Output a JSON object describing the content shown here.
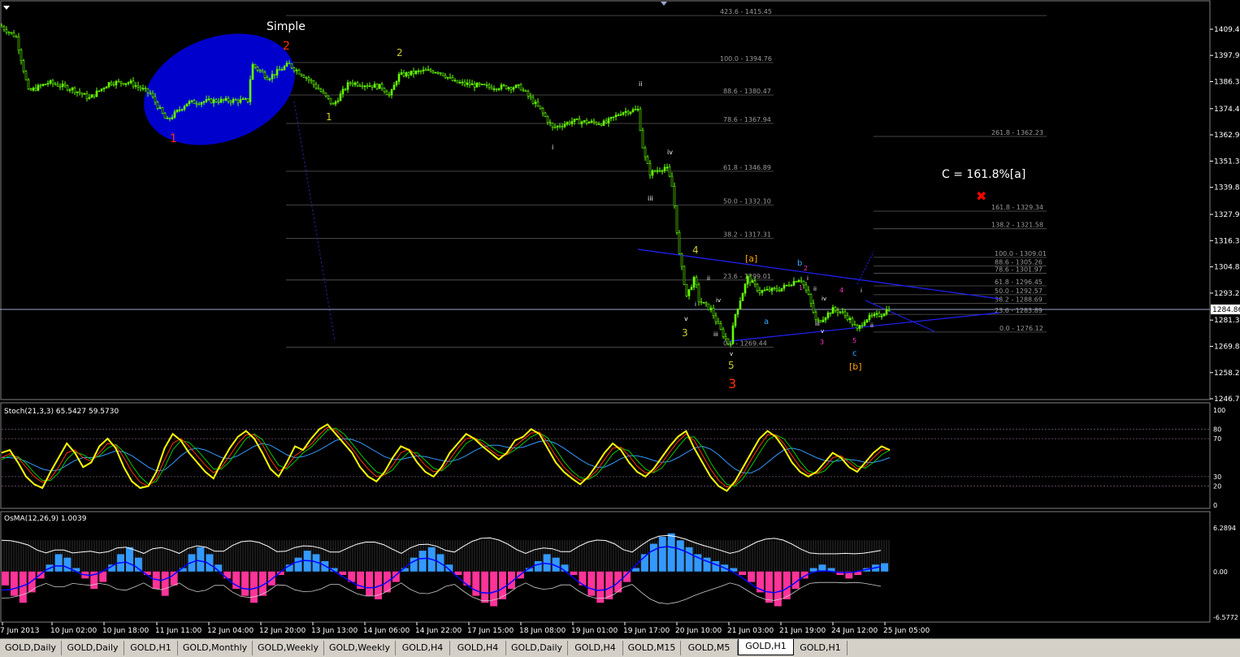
{
  "chart_data": [
    {
      "type": "candlestick",
      "symbol": "GOLD",
      "timeframe": "H1",
      "ylim": [
        1246.75,
        1418.0
      ],
      "y_ticks": [
        "1409.42",
        "1397.90",
        "1386.37",
        "1374.45",
        "1362.92",
        "1351.37",
        "1339.82",
        "1327.90",
        "1316.37",
        "1304.82",
        "1293.27",
        "1281.37",
        "1269.82",
        "1258.27",
        "1246.75"
      ],
      "current_price": "1284.86",
      "x_ticks": [
        "7 Jun 2013",
        "10 Jun 02:00",
        "10 Jun 18:00",
        "11 Jun 11:00",
        "12 Jun 04:00",
        "12 Jun 20:00",
        "13 Jun 13:00",
        "14 Jun 06:00",
        "14 Jun 22:00",
        "17 Jun 15:00",
        "18 Jun 08:00",
        "19 Jun 01:00",
        "19 Jun 17:00",
        "20 Jun 10:00",
        "21 Jun 03:00",
        "21 Jun 19:00",
        "24 Jun 12:00",
        "25 Jun 05:00"
      ],
      "price_path": [
        [
          0,
          1411
        ],
        [
          20,
          1406
        ],
        [
          35,
          1382
        ],
        [
          60,
          1386
        ],
        [
          90,
          1383
        ],
        [
          110,
          1379
        ],
        [
          135,
          1386
        ],
        [
          160,
          1386
        ],
        [
          185,
          1381
        ],
        [
          205,
          1369
        ],
        [
          230,
          1377
        ],
        [
          265,
          1378
        ],
        [
          305,
          1378
        ],
        [
          310,
          1394
        ],
        [
          330,
          1388
        ],
        [
          355,
          1394
        ],
        [
          378,
          1388
        ],
        [
          395,
          1382
        ],
        [
          410,
          1376
        ],
        [
          430,
          1386
        ],
        [
          470,
          1384
        ],
        [
          480,
          1380
        ],
        [
          490,
          1389
        ],
        [
          520,
          1391
        ],
        [
          540,
          1391
        ],
        [
          560,
          1386
        ],
        [
          600,
          1384
        ],
        [
          640,
          1384
        ],
        [
          665,
          1374
        ],
        [
          680,
          1366
        ],
        [
          705,
          1369
        ],
        [
          745,
          1368
        ],
        [
          765,
          1373
        ],
        [
          785,
          1374
        ],
        [
          792,
          1355
        ],
        [
          800,
          1346
        ],
        [
          820,
          1349
        ],
        [
          828,
          1339
        ],
        [
          836,
          1310
        ],
        [
          845,
          1292
        ],
        [
          855,
          1300
        ],
        [
          860,
          1290
        ],
        [
          875,
          1286
        ],
        [
          885,
          1278
        ],
        [
          898,
          1270
        ],
        [
          905,
          1284
        ],
        [
          920,
          1300
        ],
        [
          935,
          1294
        ],
        [
          960,
          1295
        ],
        [
          985,
          1300
        ],
        [
          995,
          1292
        ],
        [
          1005,
          1280
        ],
        [
          1015,
          1283
        ],
        [
          1025,
          1286
        ],
        [
          1035,
          1285
        ],
        [
          1045,
          1282
        ],
        [
          1055,
          1277
        ],
        [
          1065,
          1282
        ],
        [
          1075,
          1283
        ],
        [
          1085,
          1284
        ],
        [
          1095,
          1287
        ]
      ],
      "fibonacci_levels": [
        {
          "level": "423.6",
          "price": "1415.45"
        },
        {
          "level": "100.0",
          "price": "1394.76"
        },
        {
          "level": "88.6",
          "price": "1380.47"
        },
        {
          "level": "78.6",
          "price": "1367.94"
        },
        {
          "level": "261.8",
          "price": "1362.23"
        },
        {
          "level": "61.8",
          "price": "1346.89"
        },
        {
          "level": "50.0",
          "price": "1332.10"
        },
        {
          "level": "161.8",
          "price": "1329.34"
        },
        {
          "level": "138.2",
          "price": "1321.58"
        },
        {
          "level": "38.2",
          "price": "1317.31"
        },
        {
          "level": "100.0",
          "price": "1309.01"
        },
        {
          "level": "88.6",
          "price": "1305.26"
        },
        {
          "level": "78.6",
          "price": "1301.97"
        },
        {
          "level": "23.6",
          "price": "1299.01"
        },
        {
          "level": "61.8",
          "price": "1296.45"
        },
        {
          "level": "50.0",
          "price": "1292.57"
        },
        {
          "level": "38.2",
          "price": "1288.69"
        },
        {
          "level": "23.6",
          "price": "1283.89"
        },
        {
          "level": "0.0",
          "price": "1276.12"
        },
        {
          "level": "0.0",
          "price": "1269.44"
        }
      ],
      "wave_labels": [
        "Simple",
        "1",
        "2",
        "1",
        "2",
        "3",
        "4",
        "5",
        "3",
        "i",
        "ii",
        "iii",
        "iv",
        "v",
        "i",
        "ii",
        "iii",
        "iv",
        "v",
        "a",
        "b",
        "c",
        "[a]",
        "[b]",
        "1",
        "2",
        "3",
        "4",
        "5",
        "i",
        "ii",
        "iii",
        "iv",
        "v",
        "i",
        "ii"
      ],
      "annotation": "C = 161.8%[a]",
      "colors": {
        "bull_candle": "#66ff00",
        "trendline": "#0000ff",
        "ellipse": "#0000cc",
        "wave_red": "#ff3300",
        "wave_orange": "#ffa500",
        "wave_yellow": "#cccc33",
        "marker": "#ff0000"
      }
    },
    {
      "type": "line",
      "indicator_label": "Stoch(21,3,3) 65.5427 59.5730",
      "ylim": [
        0,
        100
      ],
      "y_ticks": [
        "100",
        "80",
        "70",
        "30",
        "20",
        "0"
      ],
      "levels": [
        80,
        70,
        30,
        20
      ],
      "series": [
        {
          "name": "",
          "color": "#ffff00",
          "values": [
            55,
            58,
            45,
            30,
            22,
            18,
            35,
            50,
            65,
            55,
            40,
            45,
            62,
            70,
            60,
            40,
            25,
            18,
            20,
            35,
            60,
            75,
            68,
            55,
            45,
            35,
            28,
            45,
            60,
            72,
            78,
            70,
            55,
            38,
            30,
            45,
            62,
            58,
            70,
            80,
            85,
            75,
            65,
            55,
            40,
            30,
            25,
            35,
            50,
            62,
            58,
            45,
            35,
            30,
            40,
            55,
            65,
            75,
            70,
            62,
            55,
            48,
            55,
            68,
            72,
            80,
            75,
            60,
            45,
            35,
            28,
            22,
            30,
            42,
            55,
            65,
            58,
            45,
            35,
            30,
            38,
            50,
            62,
            72,
            78,
            60,
            45,
            30,
            20,
            15,
            25,
            40,
            55,
            70,
            78,
            72,
            60,
            45,
            35,
            30,
            35,
            45,
            55,
            50,
            40,
            35,
            45,
            55,
            62,
            58
          ]
        },
        {
          "name": "",
          "color": "#ff3300",
          "values": [
            50,
            54,
            50,
            40,
            30,
            24,
            28,
            40,
            55,
            58,
            50,
            46,
            55,
            65,
            63,
            50,
            35,
            24,
            20,
            28,
            48,
            65,
            70,
            62,
            52,
            42,
            34,
            40,
            52,
            65,
            74,
            74,
            64,
            48,
            36,
            40,
            52,
            58,
            64,
            74,
            82,
            79,
            70,
            60,
            48,
            38,
            30,
            32,
            42,
            55,
            59,
            52,
            42,
            35,
            37,
            48,
            60,
            70,
            71,
            65,
            58,
            52,
            53,
            62,
            69,
            76,
            77,
            66,
            52,
            40,
            32,
            26,
            28,
            36,
            48,
            60,
            61,
            52,
            41,
            34,
            35,
            44,
            56,
            67,
            75,
            68,
            53,
            38,
            26,
            19,
            22,
            33,
            48,
            62,
            74,
            74,
            65,
            52,
            40,
            33,
            33,
            40,
            50,
            52,
            45,
            38,
            41,
            50,
            58,
            59
          ]
        },
        {
          "name": "",
          "color": "#00cc00",
          "values": [
            48,
            52,
            51,
            44,
            34,
            26,
            26,
            34,
            48,
            56,
            53,
            48,
            52,
            60,
            64,
            56,
            42,
            30,
            22,
            25,
            40,
            58,
            68,
            66,
            58,
            48,
            38,
            38,
            46,
            58,
            70,
            75,
            69,
            55,
            42,
            38,
            46,
            55,
            61,
            70,
            79,
            81,
            75,
            65,
            54,
            44,
            35,
            32,
            37,
            48,
            56,
            55,
            47,
            39,
            36,
            43,
            54,
            65,
            70,
            68,
            62,
            56,
            53,
            58,
            65,
            72,
            76,
            71,
            59,
            46,
            36,
            29,
            27,
            32,
            42,
            54,
            60,
            57,
            47,
            38,
            34,
            39,
            50,
            61,
            71,
            72,
            61,
            45,
            32,
            22,
            20,
            28,
            41,
            55,
            68,
            74,
            70,
            59,
            46,
            36,
            33,
            36,
            45,
            50,
            48,
            41,
            39,
            45,
            53,
            58
          ]
        },
        {
          "name": "",
          "color": "#3399ff",
          "values": [
            50,
            50,
            49,
            46,
            42,
            38,
            36,
            37,
            42,
            47,
            50,
            50,
            51,
            54,
            57,
            56,
            52,
            46,
            40,
            36,
            37,
            44,
            52,
            58,
            60,
            58,
            54,
            50,
            49,
            52,
            57,
            62,
            65,
            63,
            58,
            53,
            50,
            51,
            54,
            58,
            63,
            68,
            70,
            69,
            66,
            61,
            56,
            51,
            48,
            48,
            50,
            52,
            51,
            49,
            47,
            46,
            48,
            52,
            57,
            61,
            63,
            63,
            61,
            60,
            61,
            64,
            67,
            68,
            65,
            60,
            54,
            48,
            43,
            40,
            40,
            44,
            49,
            52,
            52,
            50,
            47,
            45,
            46,
            50,
            55,
            60,
            62,
            59,
            53,
            45,
            38,
            34,
            34,
            38,
            45,
            52,
            58,
            60,
            58,
            54,
            50,
            47,
            46,
            47,
            48,
            47,
            45,
            45,
            47,
            50
          ]
        }
      ]
    },
    {
      "type": "bar",
      "indicator_label": "OsMA(12,26,9) 1.0039",
      "ylim": [
        -6.5772,
        6.2894
      ],
      "y_ticks": [
        "6.2894",
        "0.00",
        "-6.5772"
      ],
      "values": [
        -2,
        -3.5,
        -4.5,
        -3,
        -1,
        1,
        2.5,
        2,
        0.5,
        -1,
        -2.5,
        -1.5,
        1,
        2.5,
        3.5,
        2,
        -0.5,
        -2.5,
        -3.5,
        -2,
        0.5,
        2.5,
        3.5,
        2.5,
        1,
        -1,
        -2.5,
        -3.5,
        -4.5,
        -3.5,
        -2,
        -0.5,
        1,
        2,
        3,
        2.5,
        1.5,
        0.5,
        -0.5,
        -1.5,
        -2.5,
        -3.5,
        -4,
        -3,
        -1.5,
        0.5,
        2,
        3,
        3.5,
        2.5,
        1,
        -0.5,
        -2,
        -3.5,
        -4.5,
        -5,
        -4,
        -2.5,
        -1,
        0.5,
        1.5,
        2.5,
        2,
        1,
        -0.5,
        -2,
        -3.5,
        -4.5,
        -4,
        -3,
        -1.5,
        0.5,
        2.5,
        4,
        5,
        5.5,
        4.5,
        3.5,
        2.5,
        2,
        1.5,
        1,
        0.5,
        -0.5,
        -1.5,
        -3,
        -4.5,
        -5,
        -4,
        -2.5,
        -1,
        0.5,
        1,
        0.5,
        -0.5,
        -1,
        -0.5,
        0.5,
        1,
        1.2
      ],
      "signal_colors": {
        "positive": "#3399ff",
        "negative": "#ff3399",
        "macd_line": "#0000ff",
        "white_line": "#ffffff"
      }
    }
  ],
  "tabs": [
    {
      "label": "GOLD,Daily"
    },
    {
      "label": "GOLD,Daily"
    },
    {
      "label": "GOLD,H1"
    },
    {
      "label": "GOLD,Monthly"
    },
    {
      "label": "GOLD,Weekly"
    },
    {
      "label": "GOLD,Weekly"
    },
    {
      "label": "GOLD,H4"
    },
    {
      "label": "GOLD,H4"
    },
    {
      "label": "GOLD,Daily"
    },
    {
      "label": "GOLD,H4"
    },
    {
      "label": "GOLD,M15"
    },
    {
      "label": "GOLD,M5"
    },
    {
      "label": "GOLD,H1"
    },
    {
      "label": "GOLD,H1"
    }
  ],
  "active_tab": "GOLD,H1"
}
